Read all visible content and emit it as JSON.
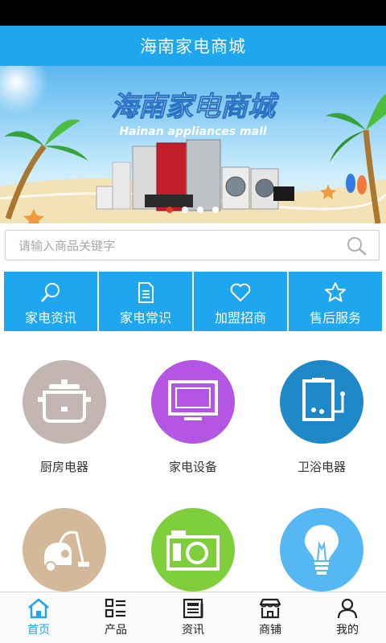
{
  "header": {
    "title": "海南家电商城"
  },
  "banner": {
    "title": "海南家电商城",
    "subtitle": "Hainan appliances mall",
    "slides": 4,
    "active_slide": 1
  },
  "search": {
    "placeholder": "请输入商品关键字"
  },
  "quick_links": [
    {
      "label": "家电资讯",
      "icon": "search-icon"
    },
    {
      "label": "家电常识",
      "icon": "document-icon"
    },
    {
      "label": "加盟招商",
      "icon": "heart-icon"
    },
    {
      "label": "售后服务",
      "icon": "star-icon"
    }
  ],
  "categories": [
    {
      "label": "厨房电器",
      "icon": "rice-cooker-icon",
      "color": "#c2b5b2"
    },
    {
      "label": "家电设备",
      "icon": "monitor-icon",
      "color": "#b456e3"
    },
    {
      "label": "卫浴电器",
      "icon": "water-heater-icon",
      "color": "#1f88c8"
    },
    {
      "label": "",
      "icon": "vacuum-cleaner-icon",
      "color": "#d4b89a"
    },
    {
      "label": "",
      "icon": "camera-icon",
      "color": "#7fcf3c"
    },
    {
      "label": "",
      "icon": "light-bulb-icon",
      "color": "#55b8f2"
    }
  ],
  "tabs": [
    {
      "label": "首页",
      "icon": "home-icon",
      "active": true
    },
    {
      "label": "产品",
      "icon": "grid-list-icon",
      "active": false
    },
    {
      "label": "资讯",
      "icon": "news-icon",
      "active": false
    },
    {
      "label": "商铺",
      "icon": "shop-icon",
      "active": false
    },
    {
      "label": "我的",
      "icon": "user-icon",
      "active": false
    }
  ],
  "colors": {
    "primary": "#1ea6ee",
    "status_bar": "#000000"
  }
}
